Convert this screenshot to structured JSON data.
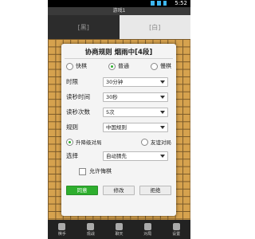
{
  "status": {
    "time": "5:52"
  },
  "topbar": {
    "title": "游戏1"
  },
  "players": {
    "left": "[黑]",
    "right": "[白]"
  },
  "dialog": {
    "title": "协商规则  烟雨中[4段]",
    "speed_options": [
      {
        "label": "快棋",
        "selected": false
      },
      {
        "label": "普通",
        "selected": true
      },
      {
        "label": "慢棋",
        "selected": false
      }
    ],
    "fields": [
      {
        "label": "时限",
        "value": "30分钟"
      },
      {
        "label": "读秒时间",
        "value": "30秒"
      },
      {
        "label": "读秒次数",
        "value": "5次"
      },
      {
        "label": "规则",
        "value": "中国规则"
      }
    ],
    "mode_options": [
      {
        "label": "升降级对局",
        "selected": true
      },
      {
        "label": "友谊对局",
        "selected": false
      }
    ],
    "select_label": "选择",
    "select_value": "自动猜先",
    "allow_undo_label": "允许悔棋",
    "buttons": {
      "agree": "同意",
      "modify": "修改",
      "reject": "拒绝"
    }
  },
  "navbar": {
    "items": [
      "棋手",
      "观战",
      "聊天",
      "对局",
      "设置"
    ]
  },
  "colors": {
    "accent": "#2eae2e",
    "board": "#d6a24e"
  }
}
